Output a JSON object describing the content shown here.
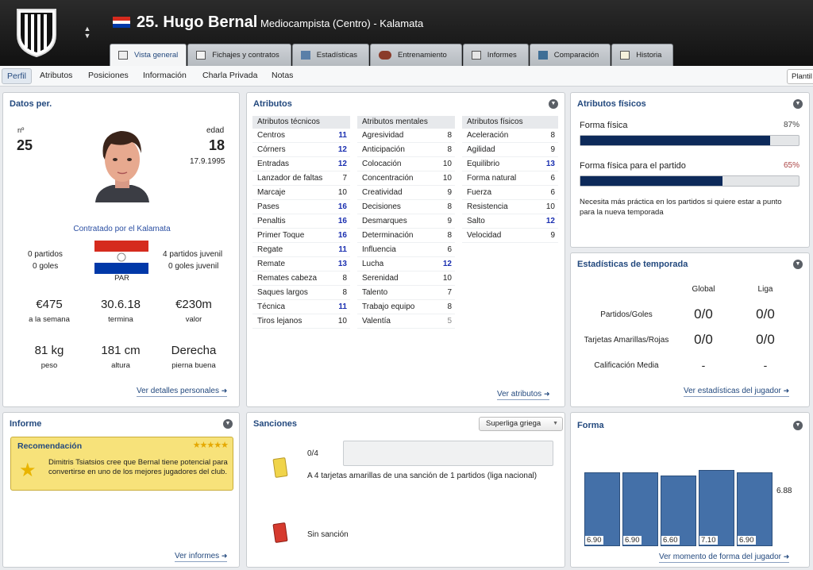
{
  "header": {
    "player_name": "25. Hugo Bernal",
    "role": "Mediocampista (Centro) - Kalamata",
    "updown": "▲\n▼"
  },
  "tabs": [
    {
      "label": "Vista general"
    },
    {
      "label": "Fichajes y contratos"
    },
    {
      "label": "Estadísticas"
    },
    {
      "label": "Entrenamiento"
    },
    {
      "label": "Informes"
    },
    {
      "label": "Comparación"
    },
    {
      "label": "Historia"
    }
  ],
  "subnav": {
    "items": [
      "Perfil",
      "Atributos",
      "Posiciones",
      "Información",
      "Charla Privada",
      "Notas"
    ],
    "plantilla": "Plantil"
  },
  "personal": {
    "title": "Datos per.",
    "num_label": "nº",
    "num": "25",
    "age_label": "edad",
    "age": "18",
    "dob": "17.9.1995",
    "contract": "Contratado por el Kalamata",
    "matches": "0 partidos",
    "goals": "0 goles",
    "youth_matches": "4 partidos juvenil",
    "youth_goals": "0 goles juvenil",
    "nation": "PAR",
    "wage": "€475",
    "wage_label": "a la semana",
    "expiry": "30.6.18",
    "expiry_label": "termina",
    "value": "€230m",
    "value_label": "valor",
    "weight": "81 kg",
    "weight_label": "peso",
    "height": "181 cm",
    "height_label": "altura",
    "foot": "Derecha",
    "foot_label": "pierna buena",
    "link": "Ver detalles personales"
  },
  "attributes": {
    "title": "Atributos",
    "link": "Ver atributos",
    "technical": {
      "header": "Atributos técnicos",
      "rows": [
        [
          "Centros",
          "11"
        ],
        [
          "Córners",
          "12"
        ],
        [
          "Entradas",
          "12"
        ],
        [
          "Lanzador de faltas",
          "7"
        ],
        [
          "Marcaje",
          "10"
        ],
        [
          "Pases",
          "16"
        ],
        [
          "Penaltis",
          "16"
        ],
        [
          "Primer Toque",
          "16"
        ],
        [
          "Regate",
          "11"
        ],
        [
          "Remate",
          "13"
        ],
        [
          "Remates cabeza",
          "8"
        ],
        [
          "Saques largos",
          "8"
        ],
        [
          "Técnica",
          "11"
        ],
        [
          "Tiros lejanos",
          "10"
        ]
      ]
    },
    "mental": {
      "header": "Atributos mentales",
      "rows": [
        [
          "Agresividad",
          "8"
        ],
        [
          "Anticipación",
          "8"
        ],
        [
          "Colocación",
          "10"
        ],
        [
          "Concentración",
          "10"
        ],
        [
          "Creatividad",
          "9"
        ],
        [
          "Decisiones",
          "8"
        ],
        [
          "Desmarques",
          "9"
        ],
        [
          "Determinación",
          "8"
        ],
        [
          "Influencia",
          "6"
        ],
        [
          "Lucha",
          "12"
        ],
        [
          "Serenidad",
          "10"
        ],
        [
          "Talento",
          "7"
        ],
        [
          "Trabajo equipo",
          "8"
        ],
        [
          "Valentía",
          "5"
        ]
      ]
    },
    "physical": {
      "header": "Atributos físicos",
      "rows": [
        [
          "Aceleración",
          "8"
        ],
        [
          "Agilidad",
          "9"
        ],
        [
          "Equilibrio",
          "13"
        ],
        [
          "Forma natural",
          "6"
        ],
        [
          "Fuerza",
          "6"
        ],
        [
          "Resistencia",
          "10"
        ],
        [
          "Salto",
          "12"
        ],
        [
          "Velocidad",
          "9"
        ]
      ]
    }
  },
  "fitness": {
    "title": "Atributos físicos",
    "form_label": "Forma física",
    "form_value": "87%",
    "form_pct": 87,
    "match_label": "Forma física para el partido",
    "match_value": "65%",
    "match_pct": 65,
    "note": "Necesita más práctica en los partidos si quiere estar a punto para la nueva temporada"
  },
  "season": {
    "title": "Estadísticas de temporada",
    "col_global": "Global",
    "col_league": "Liga",
    "rows": [
      {
        "label": "Partidos/Goles",
        "global": "0/0",
        "league": "0/0"
      },
      {
        "label": "Tarjetas Amarillas/Rojas",
        "global": "0/0",
        "league": "0/0"
      },
      {
        "label": "Calificación Media",
        "global": "-",
        "league": "-"
      }
    ],
    "link": "Ver estadísticas del jugador"
  },
  "report": {
    "title": "Informe",
    "rec_title": "Recomendación",
    "stars": "★★★★★",
    "text": "Dimitris Tsiatsios cree que Bernal tiene potencial para convertirse en uno de los mejores jugadores del club.",
    "link": "Ver informes"
  },
  "sanctions": {
    "title": "Sanciones",
    "competition": "Superliga griega",
    "count": "0/4",
    "yellow_text": "A 4 tarjetas amarillas de una sanción de 1 partidos (liga nacional)",
    "red_text": "Sin sanción",
    "progress": 0
  },
  "form": {
    "title": "Forma",
    "average": "6.88",
    "link": "Ver momento de forma del jugador",
    "chart_data": {
      "type": "bar",
      "categories": [
        "1",
        "2",
        "3",
        "4",
        "5"
      ],
      "values": [
        6.9,
        6.9,
        6.6,
        7.1,
        6.9
      ],
      "labels": [
        "6.90",
        "6.90",
        "6.60",
        "7.10",
        "6.90"
      ],
      "average": 6.88
    }
  },
  "colors": {
    "accent": "#23497e",
    "bar": "#4470a8",
    "fitness": "#0d2a5a",
    "highlight": "#1a2fb0"
  }
}
